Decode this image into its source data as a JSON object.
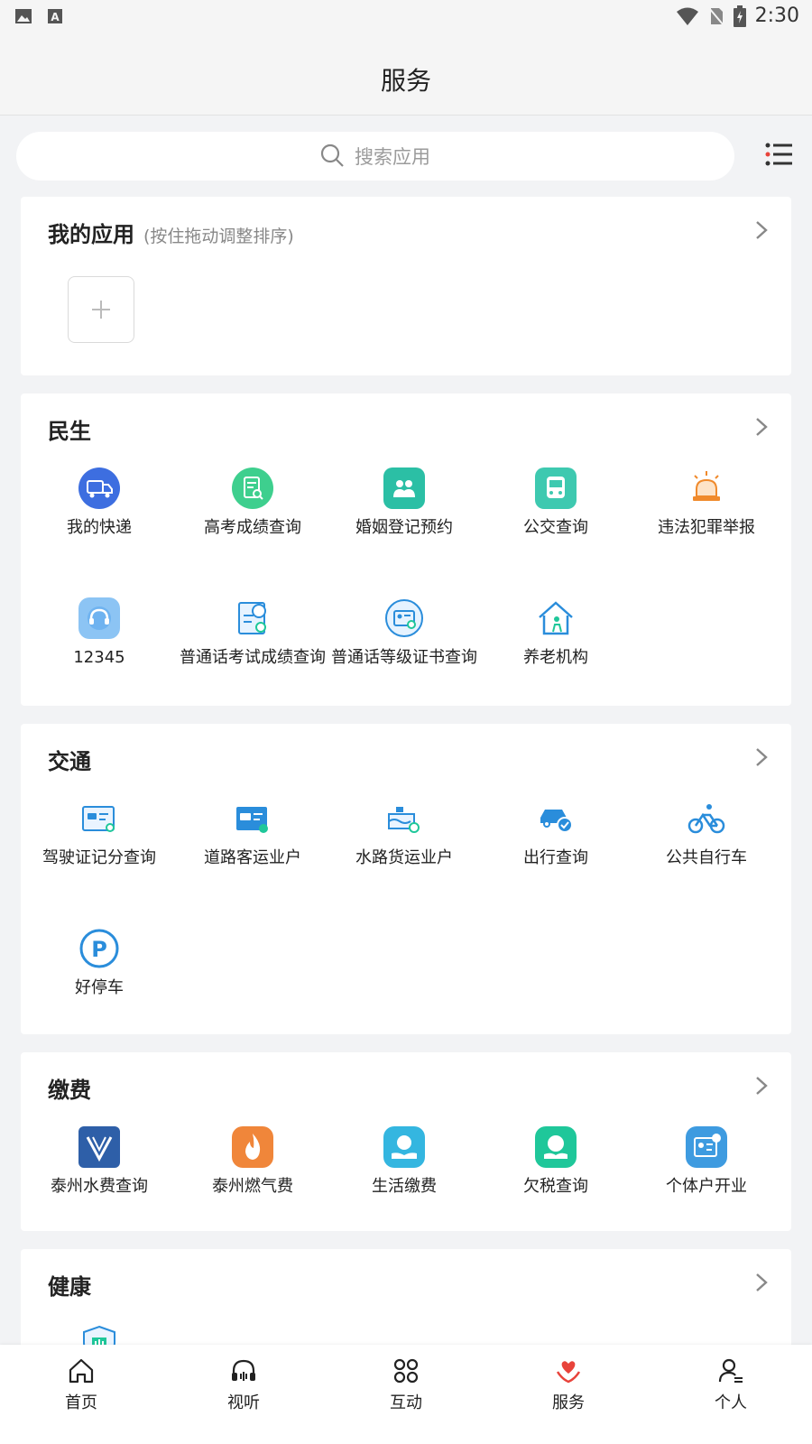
{
  "status_bar": {
    "time": "2:30"
  },
  "header": {
    "title": "服务"
  },
  "search": {
    "placeholder": "搜索应用"
  },
  "my_apps": {
    "title": "我的应用",
    "hint": "(按住拖动调整排序)"
  },
  "sections": [
    {
      "title": "民生",
      "apps": [
        {
          "label": "我的快递",
          "icon": "delivery-truck-icon",
          "color": "#3d6ee0"
        },
        {
          "label": "高考成绩查询",
          "icon": "exam-score-search-icon",
          "color": "#3ecf8e"
        },
        {
          "label": "婚姻登记预约",
          "icon": "marriage-icon",
          "color": "#2bbfa5"
        },
        {
          "label": "公交查询",
          "icon": "bus-icon",
          "color": "#3ec9b0"
        },
        {
          "label": "违法犯罪举报",
          "icon": "alarm-icon",
          "color": "#f08a2c"
        },
        {
          "label": "12345",
          "icon": "hotline-icon",
          "color": "#6fb3f0"
        },
        {
          "label": "普通话考试成绩查询",
          "icon": "mandarin-exam-icon",
          "color": "#2a8ddb"
        },
        {
          "label": "普通话等级证书查询",
          "icon": "certificate-search-icon",
          "color": "#2a8ddb"
        },
        {
          "label": "养老机构",
          "icon": "elderly-home-icon",
          "color": "#2a8ddb"
        }
      ]
    },
    {
      "title": "交通",
      "apps": [
        {
          "label": "驾驶证记分查询",
          "icon": "license-points-icon",
          "color": "#2a8ddb"
        },
        {
          "label": "道路客运业户",
          "icon": "road-transport-icon",
          "color": "#2a8ddb"
        },
        {
          "label": "水路货运业户",
          "icon": "waterway-cargo-icon",
          "color": "#2a8ddb"
        },
        {
          "label": "出行查询",
          "icon": "car-check-icon",
          "color": "#2a8ddb"
        },
        {
          "label": "公共自行车",
          "icon": "bicycle-icon",
          "color": "#2a8ddb"
        },
        {
          "label": "好停车",
          "icon": "parking-icon",
          "color": "#2a8ddb"
        }
      ]
    },
    {
      "title": "缴费",
      "apps": [
        {
          "label": "泰州水费查询",
          "icon": "water-bill-icon",
          "color": "#2e5fa8"
        },
        {
          "label": "泰州燃气费",
          "icon": "gas-flame-icon",
          "color": "#f0863a"
        },
        {
          "label": "生活缴费",
          "icon": "payment-hand-icon",
          "color": "#34b6e0"
        },
        {
          "label": "欠税查询",
          "icon": "tax-icon",
          "color": "#1fc79a"
        },
        {
          "label": "个体户开业",
          "icon": "business-license-icon",
          "color": "#3e9be0"
        }
      ]
    },
    {
      "title": "健康",
      "apps": [
        {
          "label": "",
          "icon": "hospital-shield-icon",
          "color": "#2a8ddb"
        }
      ]
    }
  ],
  "bottom_nav": [
    {
      "label": "首页",
      "icon": "home-icon"
    },
    {
      "label": "视听",
      "icon": "headphones-icon"
    },
    {
      "label": "互动",
      "icon": "grid-icon"
    },
    {
      "label": "服务",
      "icon": "heart-hand-icon",
      "active_color": "#e8433b"
    },
    {
      "label": "个人",
      "icon": "user-icon"
    }
  ]
}
